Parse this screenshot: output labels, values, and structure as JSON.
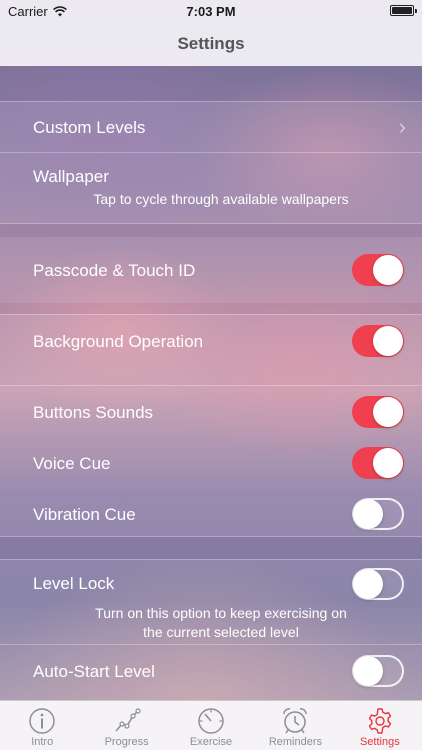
{
  "status_bar": {
    "carrier": "Carrier",
    "time": "7:03 PM"
  },
  "nav": {
    "title": "Settings"
  },
  "settings": {
    "custom_levels": {
      "label": "Custom Levels"
    },
    "wallpaper": {
      "label": "Wallpaper",
      "subtitle": "Tap to cycle through available wallpapers"
    },
    "passcode": {
      "label": "Passcode & Touch ID",
      "on": true
    },
    "background_operation": {
      "label": "Background Operation",
      "on": true
    },
    "buttons_sounds": {
      "label": "Buttons Sounds",
      "on": true
    },
    "voice_cue": {
      "label": "Voice Cue",
      "on": true
    },
    "vibration_cue": {
      "label": "Vibration Cue",
      "on": false
    },
    "level_lock": {
      "label": "Level Lock",
      "on": false,
      "subtitle_line1": "Turn on this option to keep exercising on",
      "subtitle_line2": "the current selected level"
    },
    "auto_start_level": {
      "label": "Auto-Start Level",
      "on": false
    }
  },
  "tabs": [
    {
      "label": "Intro",
      "icon": "info-icon"
    },
    {
      "label": "Progress",
      "icon": "progress-chart-icon"
    },
    {
      "label": "Exercise",
      "icon": "timer-gauge-icon"
    },
    {
      "label": "Reminders",
      "icon": "alarm-clock-icon"
    },
    {
      "label": "Settings",
      "icon": "gear-icon"
    }
  ],
  "colors": {
    "accent": "#e8343f",
    "toggle_on": "#f0404f",
    "tab_inactive": "#8e8e93"
  }
}
